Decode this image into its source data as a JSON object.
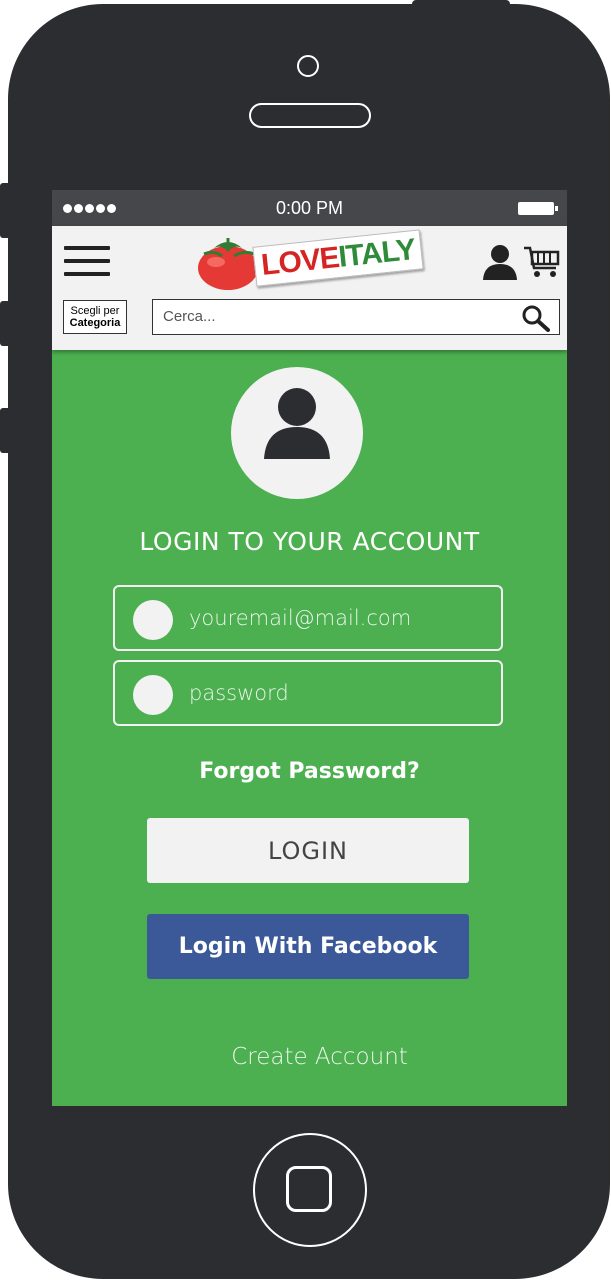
{
  "status_bar": {
    "signal_dots": 5,
    "time": "0:00 PM"
  },
  "header": {
    "logo": {
      "love": "LOVE",
      "italy": "ITALY"
    },
    "category_button": {
      "line1": "Scegli per",
      "line2": "Categoria"
    },
    "search": {
      "placeholder": "Cerca..."
    }
  },
  "login": {
    "title": "LOGIN TO YOUR ACCOUNT",
    "email_placeholder": "youremail@mail.com",
    "password_placeholder": "password",
    "forgot_link": "Forgot Password?",
    "login_button": "LOGIN",
    "facebook_button": "Login With Facebook",
    "create_account_link": "Create Account"
  },
  "colors": {
    "screen_bg": "#4caf50",
    "phone_body": "#2c2d31",
    "facebook": "#3b5998",
    "light": "#f2f2f2"
  }
}
